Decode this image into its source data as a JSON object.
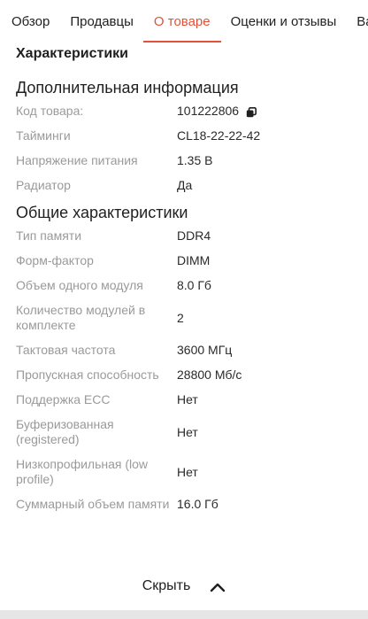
{
  "tabs": [
    {
      "label": "Обзор"
    },
    {
      "label": "Продавцы"
    },
    {
      "label": "О товаре"
    },
    {
      "label": "Оценки и отзывы"
    },
    {
      "label": "Ва"
    }
  ],
  "section_title": "Характеристики",
  "groups": [
    {
      "title": "Дополнительная информация",
      "rows": [
        {
          "label": "Код товара:",
          "value": "101222806"
        },
        {
          "label": "Тайминги",
          "value": "CL18-22-22-42"
        },
        {
          "label": "Напряжение питания",
          "value": "1.35 В"
        },
        {
          "label": "Радиатор",
          "value": "Да"
        }
      ]
    },
    {
      "title": "Общие характеристики",
      "rows": [
        {
          "label": "Тип памяти",
          "value": "DDR4"
        },
        {
          "label": "Форм-фактор",
          "value": "DIMM"
        },
        {
          "label": "Объем одного модуля",
          "value": "8.0 Гб"
        },
        {
          "label": "Количество модулей в комплекте",
          "value": "2"
        },
        {
          "label": "Тактовая частота",
          "value": "3600 МГц"
        },
        {
          "label": "Пропускная способность",
          "value": "28800 Мб/с"
        },
        {
          "label": "Поддержка ECC",
          "value": "Нет"
        },
        {
          "label": "Буферизованная (registered)",
          "value": "Нет"
        },
        {
          "label": "Низкопрофильная (low profile)",
          "value": "Нет"
        },
        {
          "label": "Суммарный объем памяти",
          "value": "16.0 Гб"
        }
      ]
    }
  ],
  "hide_button_label": "Скрыть",
  "colors": {
    "accent": "#e2523a",
    "label": "#9a9a9a"
  },
  "icons": {
    "copy": "copy-icon",
    "collapse": "chevron-up-icon"
  }
}
